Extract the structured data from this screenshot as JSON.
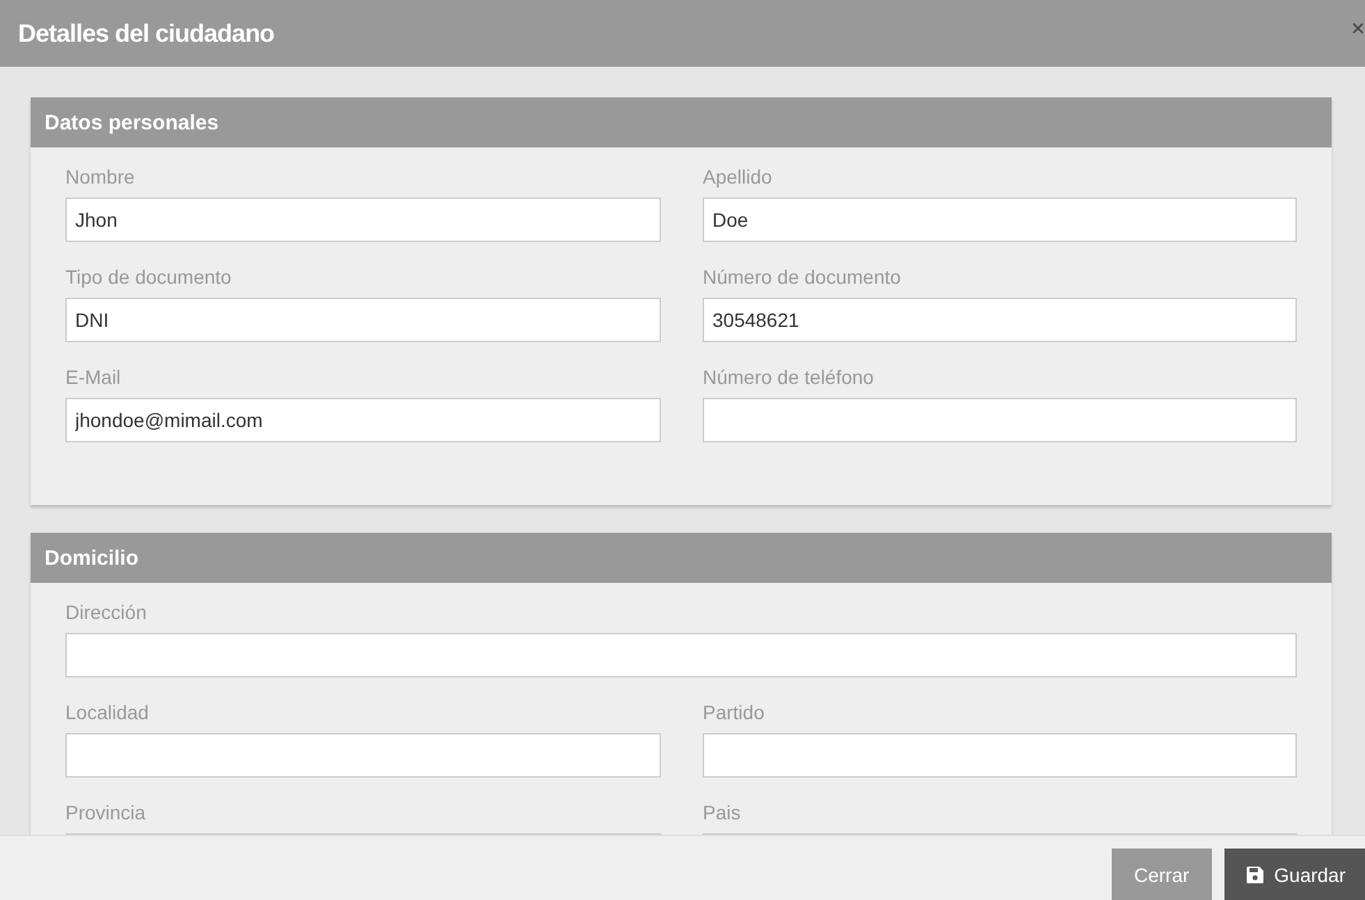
{
  "dialog": {
    "title": "Detalles del ciudadano",
    "close": "×"
  },
  "sections": [
    {
      "title": "Datos personales",
      "fields": [
        {
          "label": "Nombre",
          "value": "Jhon",
          "kind": "half"
        },
        {
          "label": "Apellido",
          "value": "Doe",
          "kind": "half"
        },
        {
          "label": "Tipo de documento",
          "value": "DNI",
          "kind": "half"
        },
        {
          "label": "Número de documento",
          "value": "30548621",
          "kind": "half"
        },
        {
          "label": "E-Mail",
          "value": "jhondoe@mimail.com",
          "kind": "half"
        },
        {
          "label": "Número de teléfono",
          "kind": "half"
        }
      ]
    },
    {
      "title": "Domicilio",
      "fields": [
        {
          "label": "Dirección",
          "kind": "full"
        },
        {
          "label": "Localidad",
          "kind": "half"
        },
        {
          "label": "Partido",
          "kind": "half"
        },
        {
          "label": "Provincia",
          "kind": "half"
        },
        {
          "label": "Pais",
          "kind": "half"
        }
      ]
    }
  ],
  "buttons": [
    {
      "label": "Cerrar",
      "kind": "secondary"
    },
    {
      "label": "Guardar",
      "kind": "primary"
    }
  ]
}
